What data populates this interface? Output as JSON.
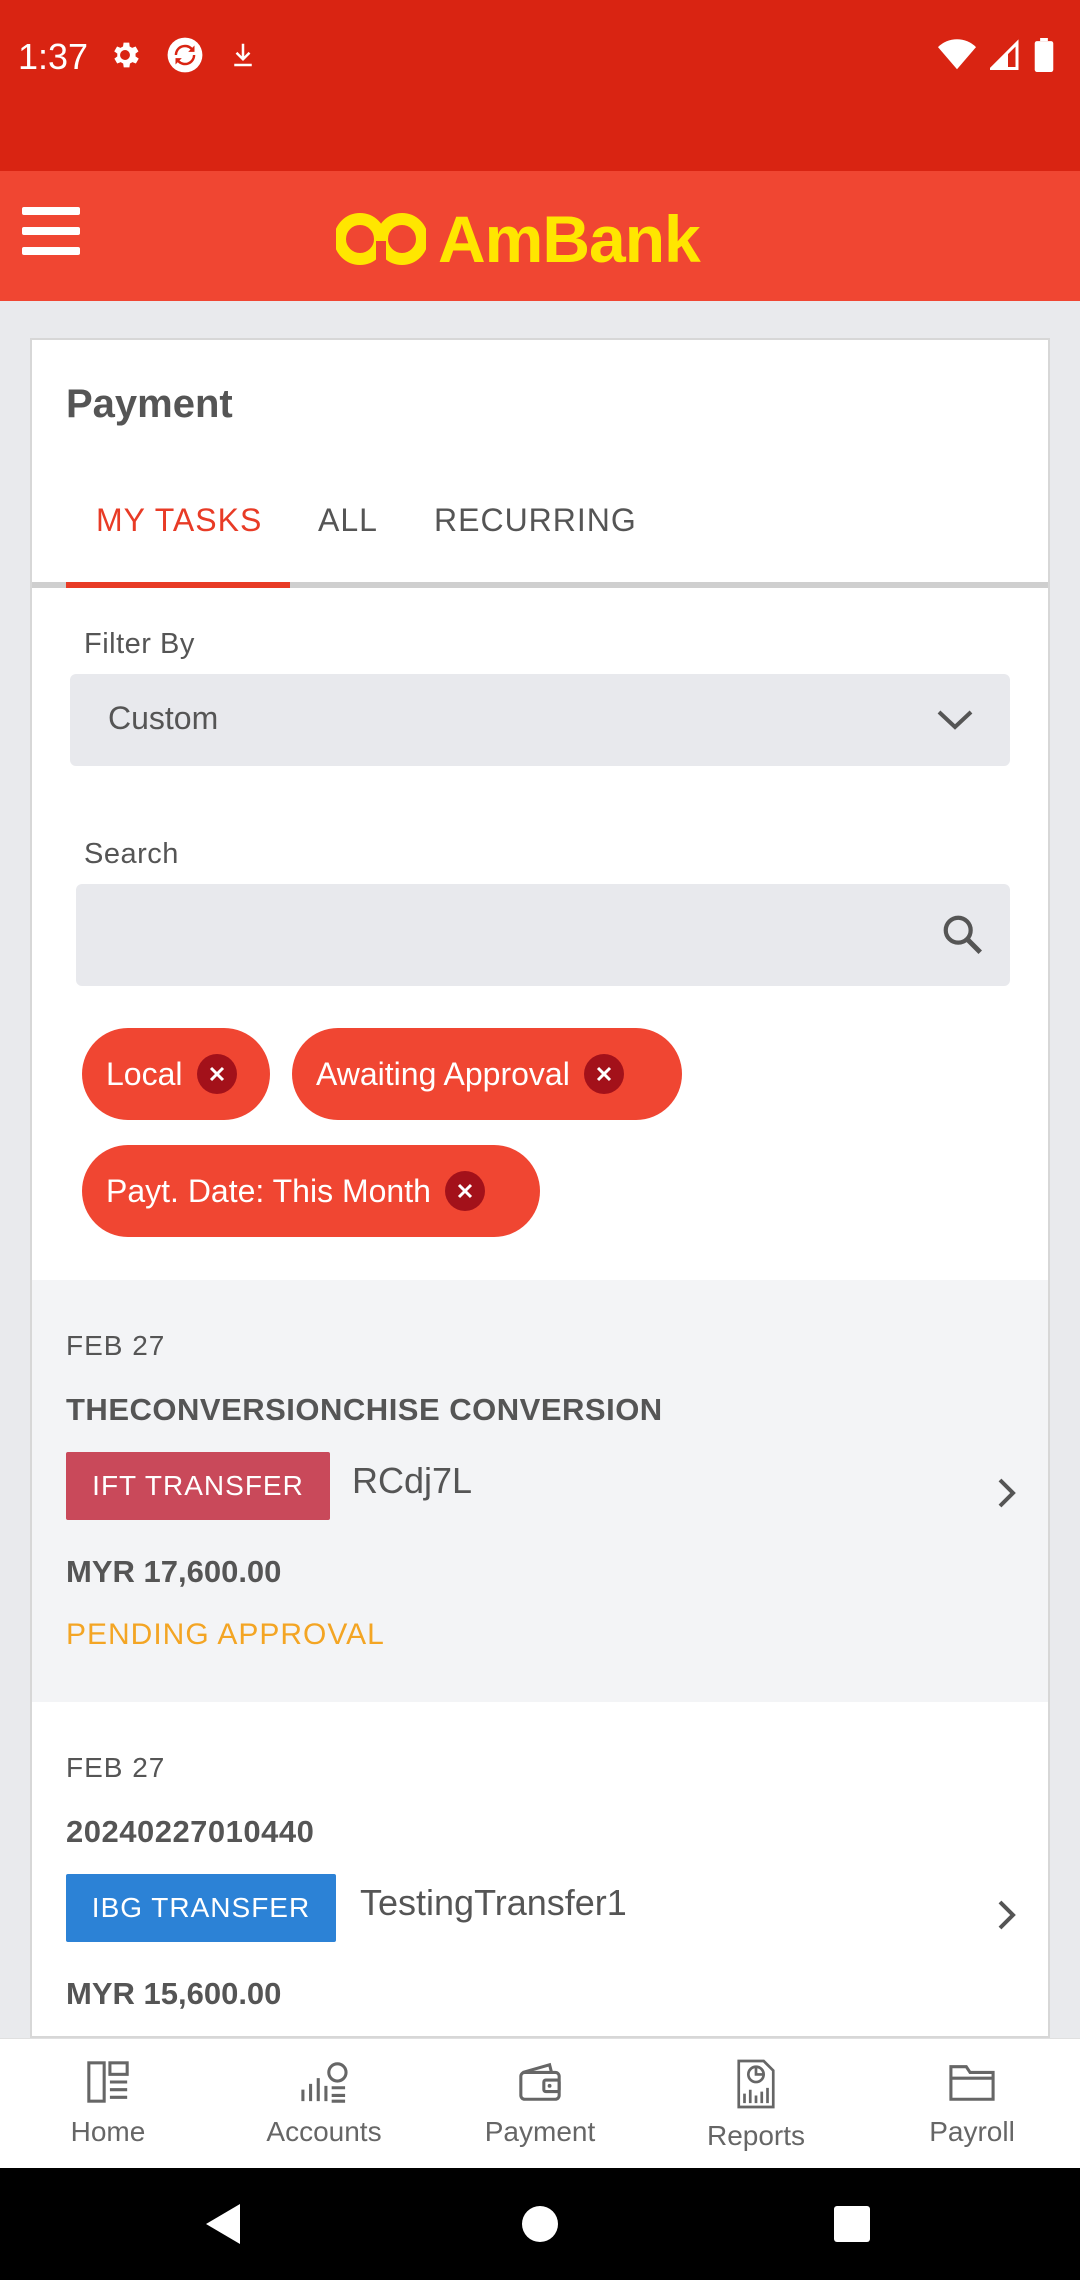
{
  "status_bar": {
    "time": "1:37"
  },
  "app_bar": {
    "logo_text": "AmBank",
    "brand_color": "#f04632",
    "logo_color": "#ffe600"
  },
  "page": {
    "title": "Payment",
    "tabs": [
      {
        "label": "MY TASKS",
        "active": true
      },
      {
        "label": "ALL",
        "active": false
      },
      {
        "label": "RECURRING",
        "active": false
      }
    ],
    "filter": {
      "label": "Filter By",
      "value": "Custom"
    },
    "search": {
      "label": "Search",
      "value": "",
      "placeholder": ""
    },
    "chips": [
      {
        "label": "Local"
      },
      {
        "label": "Awaiting Approval"
      },
      {
        "label": "Payt. Date: This Month"
      }
    ],
    "transactions": [
      {
        "date": "FEB  27",
        "name": "THECONVERSIONCHISE CONVERSION",
        "type": "IFT TRANSFER",
        "reference": "RCdj7L",
        "amount": "MYR 17,600.00",
        "status": "PENDING APPROVAL"
      },
      {
        "date": "FEB  27",
        "name": "20240227010440",
        "type": "IBG TRANSFER",
        "reference": "TestingTransfer1",
        "amount": "MYR 15,600.00",
        "status": ""
      }
    ]
  },
  "bottom_nav": [
    {
      "label": "Home",
      "icon": "home-icon"
    },
    {
      "label": "Accounts",
      "icon": "accounts-icon"
    },
    {
      "label": "Payment",
      "icon": "wallet-icon"
    },
    {
      "label": "Reports",
      "icon": "reports-icon"
    },
    {
      "label": "Payroll",
      "icon": "folder-icon"
    }
  ],
  "colors": {
    "status_pending": "#f3a524",
    "ift_badge": "#c9495a",
    "ibg_badge": "#2c82d6"
  }
}
